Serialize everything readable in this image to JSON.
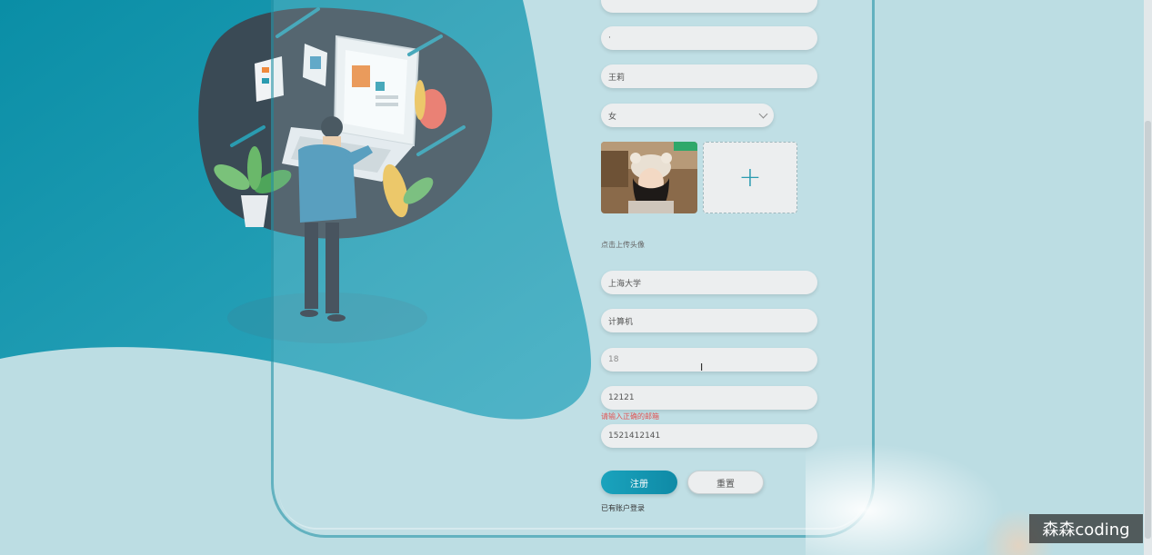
{
  "form": {
    "field_password_confirm": "·",
    "field_name": "王莉",
    "gender_selected": "女",
    "upload_hint": "点击上传头像",
    "field_school": "上海大学",
    "field_major": "计算机",
    "field_age_placeholder": "18",
    "field_email": "12121",
    "email_error": "请输入正确的邮箱",
    "field_phone": "1521412141",
    "register_label": "注册",
    "reset_label": "重置",
    "login_link": "已有账户登录"
  },
  "watermark": "森森coding",
  "icons": {
    "upload": "plus-icon",
    "select": "chevron-down-icon",
    "cursor": "text-cursor-icon"
  },
  "colors": {
    "primary": "#1aa3bd",
    "error": "#e05555",
    "background": "#bcdde3"
  }
}
